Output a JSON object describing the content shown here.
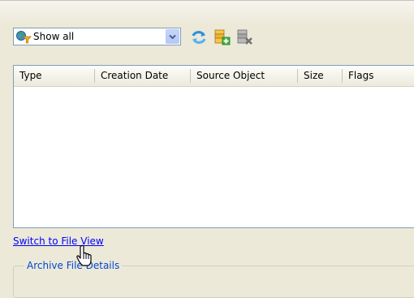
{
  "toolbar": {
    "filter": {
      "selected": "Show all",
      "icon": "globe-filter-icon"
    },
    "buttons": [
      {
        "name": "refresh",
        "icon": "refresh-icon"
      },
      {
        "name": "add-archive",
        "icon": "add-archive-icon"
      },
      {
        "name": "delete-archive",
        "icon": "delete-archive-icon"
      }
    ]
  },
  "list": {
    "columns": [
      "Type",
      "Creation Date",
      "Source Object",
      "Size",
      "Flags"
    ],
    "rows": []
  },
  "links": {
    "switch_view": "Switch to File View"
  },
  "details": {
    "legend": "Archive File Details"
  },
  "colors": {
    "window_bg": "#ECE9D8",
    "link": "#0000FF",
    "group_legend": "#0046D5",
    "border": "#7F9DB9"
  }
}
